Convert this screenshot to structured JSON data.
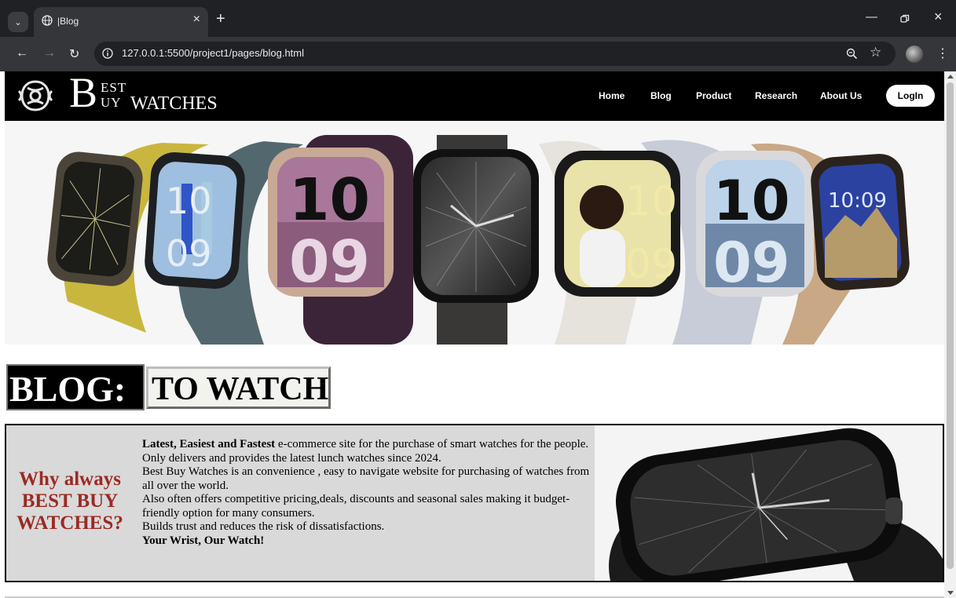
{
  "browser": {
    "tab_title": "|Blog",
    "url": "127.0.0.1:5500/project1/pages/blog.html"
  },
  "site": {
    "brand_initial": "B",
    "brand_line1": "EST",
    "brand_line2": "UY",
    "brand_word": "WATCHES",
    "nav": [
      {
        "label": "Home"
      },
      {
        "label": "Blog"
      },
      {
        "label": "Product"
      },
      {
        "label": "Research"
      },
      {
        "label": "About Us"
      }
    ],
    "login_label": "LogIn"
  },
  "heading": {
    "blog": "BLOG:",
    "sub": "TO WATCH"
  },
  "why": {
    "title_line1": "Why always",
    "title_line2": "BEST BUY",
    "title_line3": "WATCHES?",
    "p1_bold": "Latest, Easiest and Fastest",
    "p1_rest": " e-commerce site for the purchase of smart watches for the people.",
    "p2": "Only delivers and provides the latest lunch watches since 2024.",
    "p3": "Best Buy Watches is an convenience , easy to navigate website for purchasing of watches from all over the world.",
    "p4": "Also often offers competitive pricing,deals, discounts and seasonal sales making it budget-friendly option for many consumers.",
    "p5": "Builds trust and reduces the risk of dissatisfactions.",
    "p6_bold": "Your Wrist, Our Watch!"
  },
  "hero_faces": [
    "10",
    "10",
    "10",
    "09",
    "09",
    "10",
    "09",
    "10:09"
  ],
  "colors": {
    "chrome_dark": "#202124",
    "chrome_toolbar": "#35363a",
    "site_header": "#000000",
    "why_title": "#9b2a24",
    "why_bg": "#d9d9d9"
  }
}
